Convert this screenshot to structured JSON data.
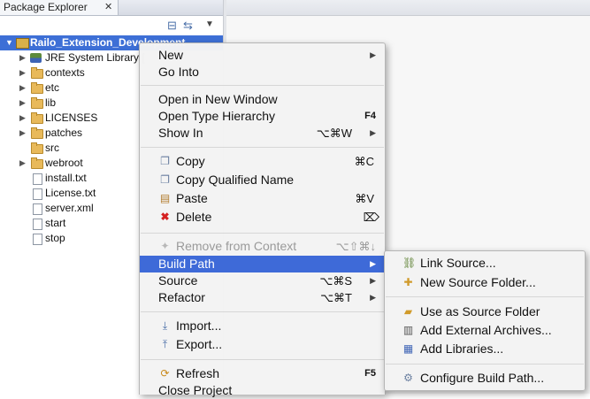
{
  "explorer": {
    "tab_title": "Package Explorer",
    "tab_close": "✕",
    "tree": [
      {
        "label": "Railo_Extension_Development",
        "kind": "project",
        "twisty": "▼",
        "selected": true
      },
      {
        "label": "JRE System Library [",
        "kind": "library",
        "twisty": "▶"
      },
      {
        "label": "contexts",
        "kind": "folder",
        "twisty": "▶"
      },
      {
        "label": "etc",
        "kind": "folder",
        "twisty": "▶"
      },
      {
        "label": "lib",
        "kind": "folder",
        "twisty": "▶"
      },
      {
        "label": "LICENSES",
        "kind": "folder",
        "twisty": "▶"
      },
      {
        "label": "patches",
        "kind": "folder",
        "twisty": "▶"
      },
      {
        "label": "src",
        "kind": "folder",
        "twisty": ""
      },
      {
        "label": "webroot",
        "kind": "folder",
        "twisty": "▶"
      },
      {
        "label": "install.txt",
        "kind": "file",
        "twisty": ""
      },
      {
        "label": "License.txt",
        "kind": "file",
        "twisty": ""
      },
      {
        "label": "server.xml",
        "kind": "file",
        "twisty": ""
      },
      {
        "label": "start",
        "kind": "file",
        "twisty": ""
      },
      {
        "label": "stop",
        "kind": "file",
        "twisty": ""
      }
    ]
  },
  "context_menu": {
    "items": [
      {
        "label": "New",
        "shortcut": "",
        "submenu": true
      },
      {
        "label": "Go Into",
        "shortcut": "",
        "submenu": false
      },
      {
        "label": "Open in New Window",
        "shortcut": "",
        "submenu": false
      },
      {
        "label": "Open Type Hierarchy",
        "shortcut": "F4",
        "submenu": false
      },
      {
        "label": "Show In",
        "shortcut": "⌥⌘W",
        "submenu": true
      },
      {
        "label": "Copy",
        "shortcut": "⌘C",
        "icon": "copy-icon"
      },
      {
        "label": "Copy Qualified Name",
        "shortcut": "",
        "icon": "copy-qualified-icon"
      },
      {
        "label": "Paste",
        "shortcut": "⌘V",
        "icon": "paste-icon"
      },
      {
        "label": "Delete",
        "shortcut": "⌦",
        "icon": "delete-icon"
      },
      {
        "label": "Remove from Context",
        "shortcut": "⌥⇧⌘↓",
        "disabled": true,
        "icon": "remove-context-icon"
      },
      {
        "label": "Build Path",
        "shortcut": "",
        "submenu": true,
        "highlighted": true
      },
      {
        "label": "Source",
        "shortcut": "⌥⌘S",
        "submenu": true
      },
      {
        "label": "Refactor",
        "shortcut": "⌥⌘T",
        "submenu": true
      },
      {
        "label": "Import...",
        "shortcut": "",
        "icon": "import-icon"
      },
      {
        "label": "Export...",
        "shortcut": "",
        "icon": "export-icon"
      },
      {
        "label": "Refresh",
        "shortcut": "F5",
        "icon": "refresh-icon"
      },
      {
        "label": "Close Project",
        "shortcut": ""
      }
    ]
  },
  "build_path_submenu": {
    "items": [
      {
        "label": "Link Source...",
        "icon": "link-source-icon"
      },
      {
        "label": "New Source Folder...",
        "icon": "new-source-folder-icon"
      },
      {
        "label": "Use as Source Folder",
        "icon": "use-source-folder-icon"
      },
      {
        "label": "Add External Archives...",
        "icon": "external-archive-icon"
      },
      {
        "label": "Add Libraries...",
        "icon": "add-libraries-icon"
      },
      {
        "label": "Configure Build Path...",
        "icon": "configure-build-path-icon"
      }
    ]
  },
  "colors": {
    "highlight": "#3e6ad8",
    "selection": "#3d6fd6",
    "folder": "#e8b95a"
  }
}
